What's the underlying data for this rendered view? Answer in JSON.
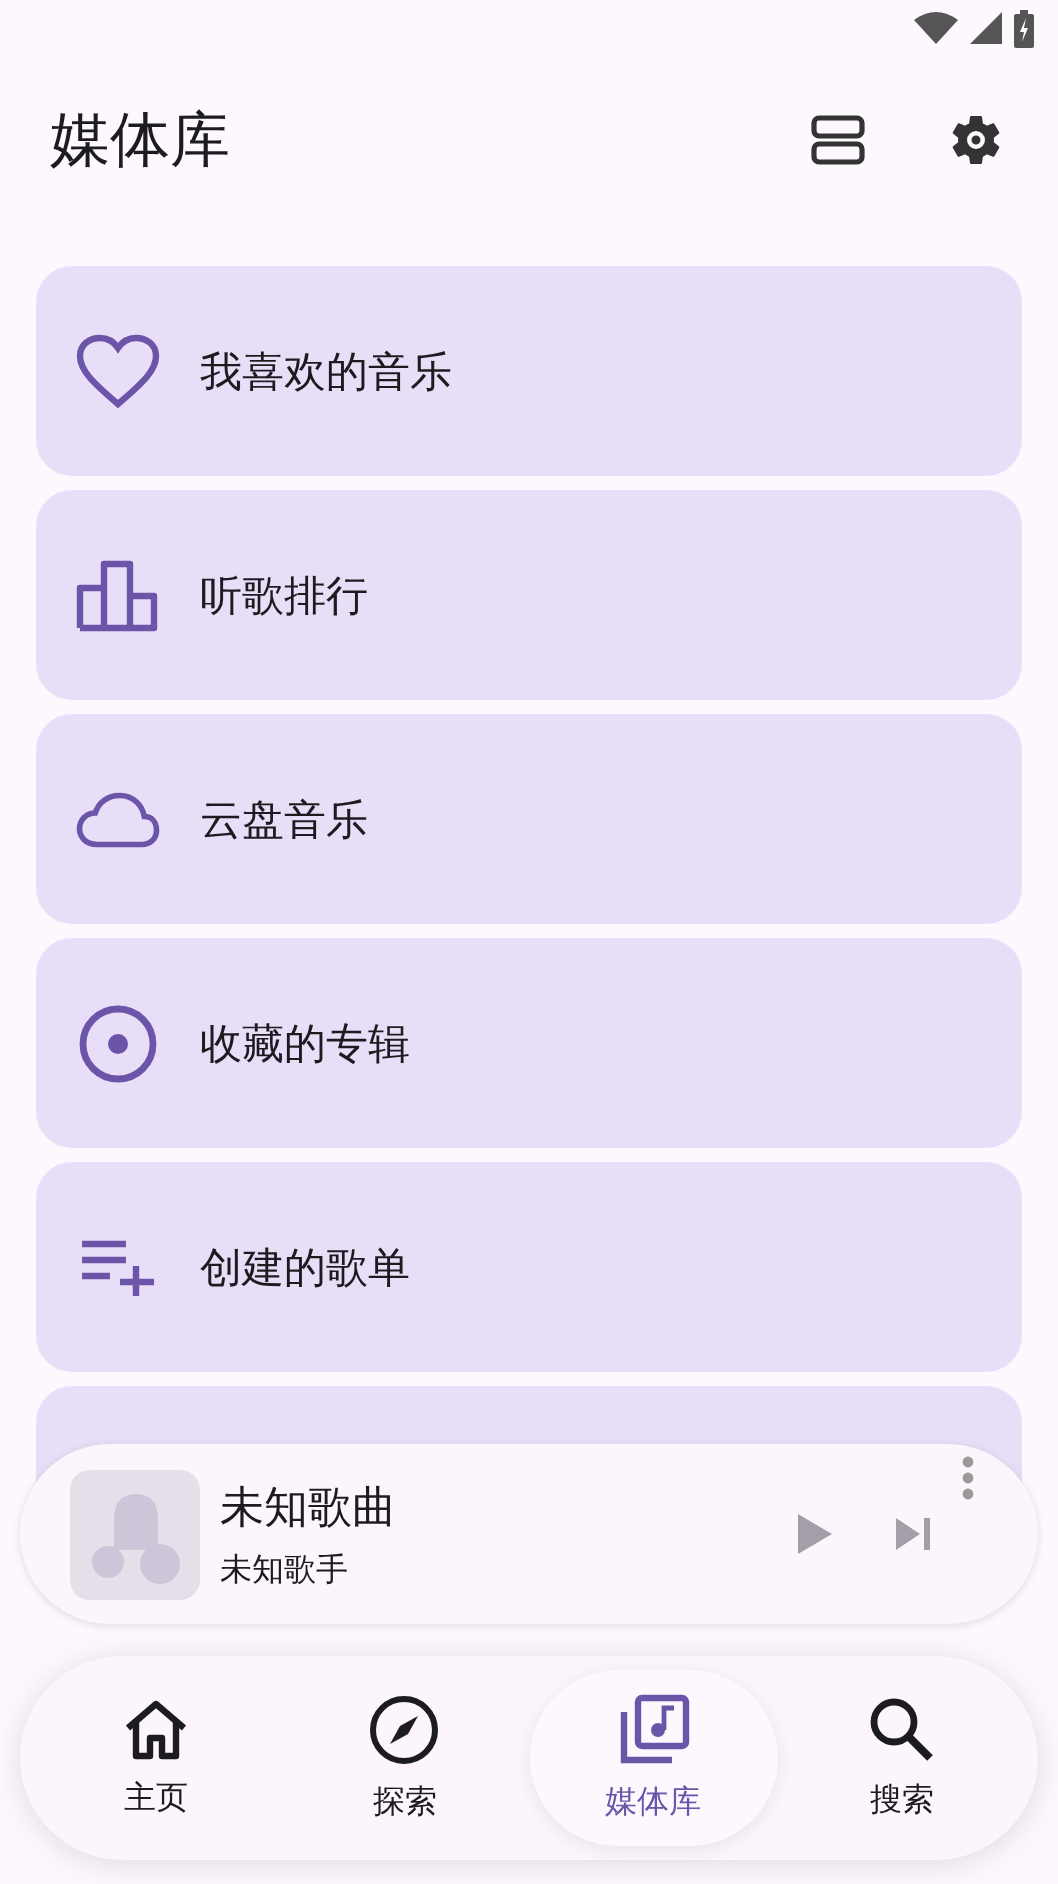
{
  "title": "媒体库",
  "library_items": [
    {
      "label": "我喜欢的音乐",
      "kind": "heart"
    },
    {
      "label": "听歌排行",
      "kind": "chart"
    },
    {
      "label": "云盘音乐",
      "kind": "cloud"
    },
    {
      "label": "收藏的专辑",
      "kind": "disc"
    },
    {
      "label": "创建的歌单",
      "kind": "playlist"
    }
  ],
  "mini_player": {
    "title": "未知歌曲",
    "artist": "未知歌手"
  },
  "nav": [
    {
      "label": "主页",
      "kind": "home",
      "selected": false
    },
    {
      "label": "探索",
      "kind": "explore",
      "selected": false
    },
    {
      "label": "媒体库",
      "kind": "library",
      "selected": true
    },
    {
      "label": "搜索",
      "kind": "search",
      "selected": false
    }
  ]
}
